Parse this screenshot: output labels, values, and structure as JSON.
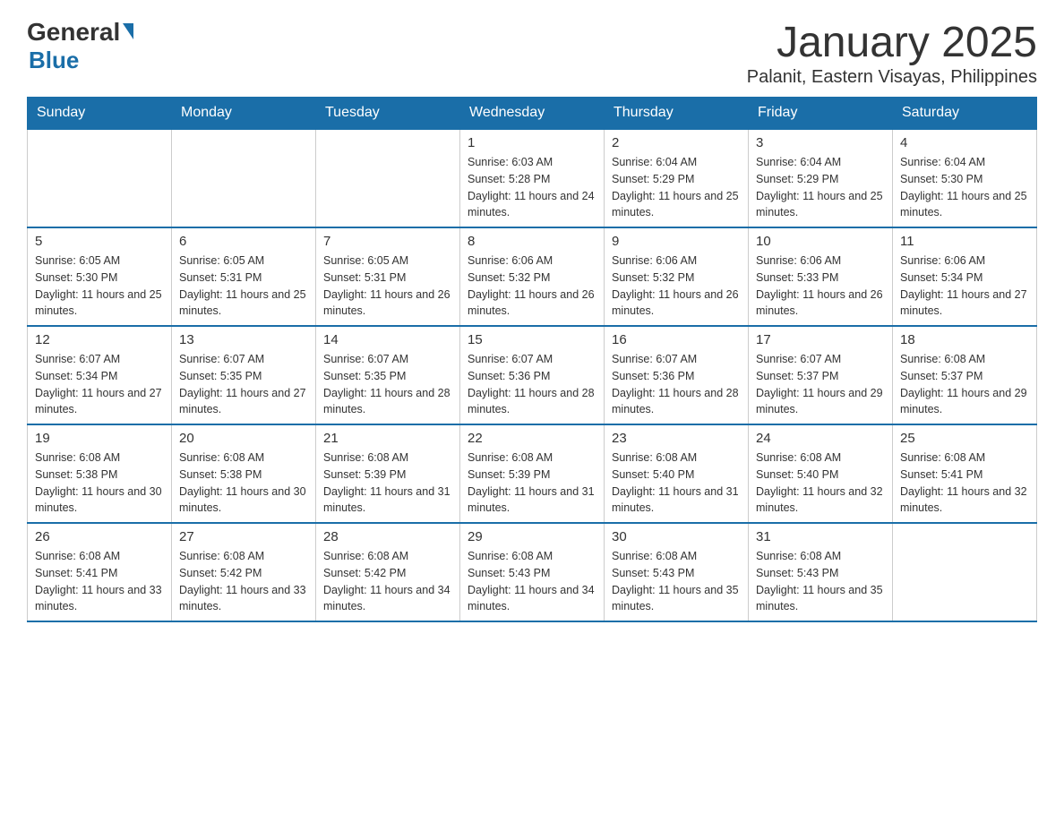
{
  "logo": {
    "text_general": "General",
    "text_blue": "Blue"
  },
  "header": {
    "month_year": "January 2025",
    "location": "Palanit, Eastern Visayas, Philippines"
  },
  "days_of_week": [
    "Sunday",
    "Monday",
    "Tuesday",
    "Wednesday",
    "Thursday",
    "Friday",
    "Saturday"
  ],
  "weeks": [
    [
      {
        "day": "",
        "info": ""
      },
      {
        "day": "",
        "info": ""
      },
      {
        "day": "",
        "info": ""
      },
      {
        "day": "1",
        "info": "Sunrise: 6:03 AM\nSunset: 5:28 PM\nDaylight: 11 hours and 24 minutes."
      },
      {
        "day": "2",
        "info": "Sunrise: 6:04 AM\nSunset: 5:29 PM\nDaylight: 11 hours and 25 minutes."
      },
      {
        "day": "3",
        "info": "Sunrise: 6:04 AM\nSunset: 5:29 PM\nDaylight: 11 hours and 25 minutes."
      },
      {
        "day": "4",
        "info": "Sunrise: 6:04 AM\nSunset: 5:30 PM\nDaylight: 11 hours and 25 minutes."
      }
    ],
    [
      {
        "day": "5",
        "info": "Sunrise: 6:05 AM\nSunset: 5:30 PM\nDaylight: 11 hours and 25 minutes."
      },
      {
        "day": "6",
        "info": "Sunrise: 6:05 AM\nSunset: 5:31 PM\nDaylight: 11 hours and 25 minutes."
      },
      {
        "day": "7",
        "info": "Sunrise: 6:05 AM\nSunset: 5:31 PM\nDaylight: 11 hours and 26 minutes."
      },
      {
        "day": "8",
        "info": "Sunrise: 6:06 AM\nSunset: 5:32 PM\nDaylight: 11 hours and 26 minutes."
      },
      {
        "day": "9",
        "info": "Sunrise: 6:06 AM\nSunset: 5:32 PM\nDaylight: 11 hours and 26 minutes."
      },
      {
        "day": "10",
        "info": "Sunrise: 6:06 AM\nSunset: 5:33 PM\nDaylight: 11 hours and 26 minutes."
      },
      {
        "day": "11",
        "info": "Sunrise: 6:06 AM\nSunset: 5:34 PM\nDaylight: 11 hours and 27 minutes."
      }
    ],
    [
      {
        "day": "12",
        "info": "Sunrise: 6:07 AM\nSunset: 5:34 PM\nDaylight: 11 hours and 27 minutes."
      },
      {
        "day": "13",
        "info": "Sunrise: 6:07 AM\nSunset: 5:35 PM\nDaylight: 11 hours and 27 minutes."
      },
      {
        "day": "14",
        "info": "Sunrise: 6:07 AM\nSunset: 5:35 PM\nDaylight: 11 hours and 28 minutes."
      },
      {
        "day": "15",
        "info": "Sunrise: 6:07 AM\nSunset: 5:36 PM\nDaylight: 11 hours and 28 minutes."
      },
      {
        "day": "16",
        "info": "Sunrise: 6:07 AM\nSunset: 5:36 PM\nDaylight: 11 hours and 28 minutes."
      },
      {
        "day": "17",
        "info": "Sunrise: 6:07 AM\nSunset: 5:37 PM\nDaylight: 11 hours and 29 minutes."
      },
      {
        "day": "18",
        "info": "Sunrise: 6:08 AM\nSunset: 5:37 PM\nDaylight: 11 hours and 29 minutes."
      }
    ],
    [
      {
        "day": "19",
        "info": "Sunrise: 6:08 AM\nSunset: 5:38 PM\nDaylight: 11 hours and 30 minutes."
      },
      {
        "day": "20",
        "info": "Sunrise: 6:08 AM\nSunset: 5:38 PM\nDaylight: 11 hours and 30 minutes."
      },
      {
        "day": "21",
        "info": "Sunrise: 6:08 AM\nSunset: 5:39 PM\nDaylight: 11 hours and 31 minutes."
      },
      {
        "day": "22",
        "info": "Sunrise: 6:08 AM\nSunset: 5:39 PM\nDaylight: 11 hours and 31 minutes."
      },
      {
        "day": "23",
        "info": "Sunrise: 6:08 AM\nSunset: 5:40 PM\nDaylight: 11 hours and 31 minutes."
      },
      {
        "day": "24",
        "info": "Sunrise: 6:08 AM\nSunset: 5:40 PM\nDaylight: 11 hours and 32 minutes."
      },
      {
        "day": "25",
        "info": "Sunrise: 6:08 AM\nSunset: 5:41 PM\nDaylight: 11 hours and 32 minutes."
      }
    ],
    [
      {
        "day": "26",
        "info": "Sunrise: 6:08 AM\nSunset: 5:41 PM\nDaylight: 11 hours and 33 minutes."
      },
      {
        "day": "27",
        "info": "Sunrise: 6:08 AM\nSunset: 5:42 PM\nDaylight: 11 hours and 33 minutes."
      },
      {
        "day": "28",
        "info": "Sunrise: 6:08 AM\nSunset: 5:42 PM\nDaylight: 11 hours and 34 minutes."
      },
      {
        "day": "29",
        "info": "Sunrise: 6:08 AM\nSunset: 5:43 PM\nDaylight: 11 hours and 34 minutes."
      },
      {
        "day": "30",
        "info": "Sunrise: 6:08 AM\nSunset: 5:43 PM\nDaylight: 11 hours and 35 minutes."
      },
      {
        "day": "31",
        "info": "Sunrise: 6:08 AM\nSunset: 5:43 PM\nDaylight: 11 hours and 35 minutes."
      },
      {
        "day": "",
        "info": ""
      }
    ]
  ]
}
